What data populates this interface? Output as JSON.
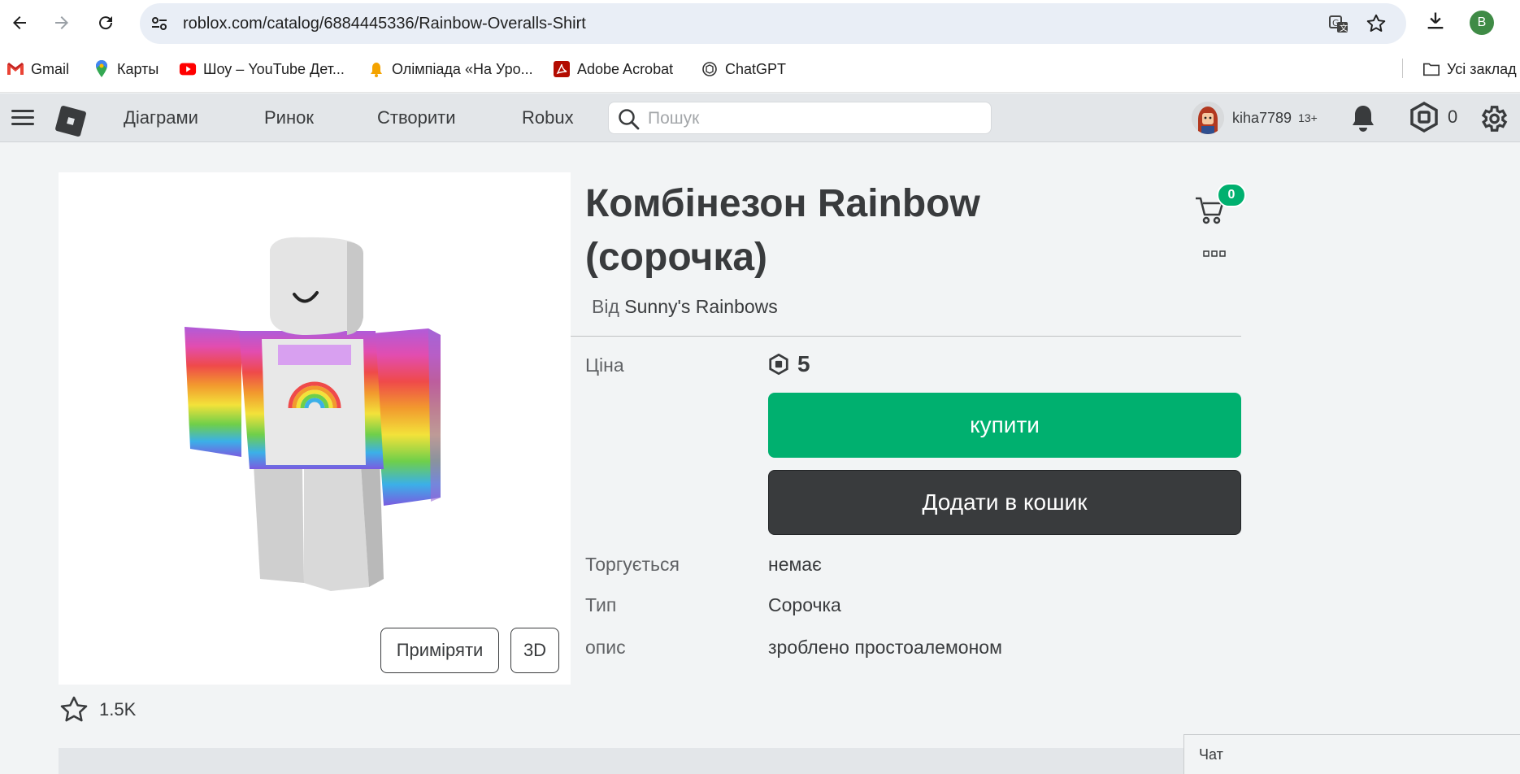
{
  "browser": {
    "url": "roblox.com/catalog/6884445336/Rainbow-Overalls-Shirt",
    "profile_initial": "B",
    "bookmarks": [
      {
        "label": "Gmail",
        "icon": "gmail-icon"
      },
      {
        "label": "Карты",
        "icon": "maps-icon"
      },
      {
        "label": "Шоу – YouTube Дет...",
        "icon": "youtube-icon"
      },
      {
        "label": "Олімпіада «На Уро...",
        "icon": "bell-icon"
      },
      {
        "label": "Adobe Acrobat",
        "icon": "acrobat-icon"
      },
      {
        "label": "ChatGPT",
        "icon": "chatgpt-icon"
      }
    ],
    "all_bookmarks": "Усі заклад"
  },
  "header": {
    "nav": [
      "Діаграми",
      "Ринок",
      "Створити",
      "Robux"
    ],
    "search_placeholder": "Пошук",
    "username": "kiha7789",
    "age_badge": "13+",
    "robux_balance": "0"
  },
  "item": {
    "title": "Комбінезон Rainbow (сорочка)",
    "creator_prefix": "Від",
    "creator": "Sunny's Rainbows",
    "cart_count": "0",
    "price_label": "Ціна",
    "price": "5",
    "buy_label": "купити",
    "add_to_cart_label": "Додати в кошик",
    "fields": [
      {
        "label": "Торгується",
        "value": "немає"
      },
      {
        "label": "Тип",
        "value": "Сорочка"
      },
      {
        "label": "опис",
        "value": "зроблено простоалемоном"
      }
    ],
    "try_on_label": "Приміряти",
    "view3d_label": "3D",
    "favorites": "1.5K"
  },
  "chat": {
    "label": "Чат"
  },
  "colors": {
    "buy_green": "#00b06f",
    "dark_button": "#393b3d",
    "header_bg": "#e3e6e9"
  }
}
